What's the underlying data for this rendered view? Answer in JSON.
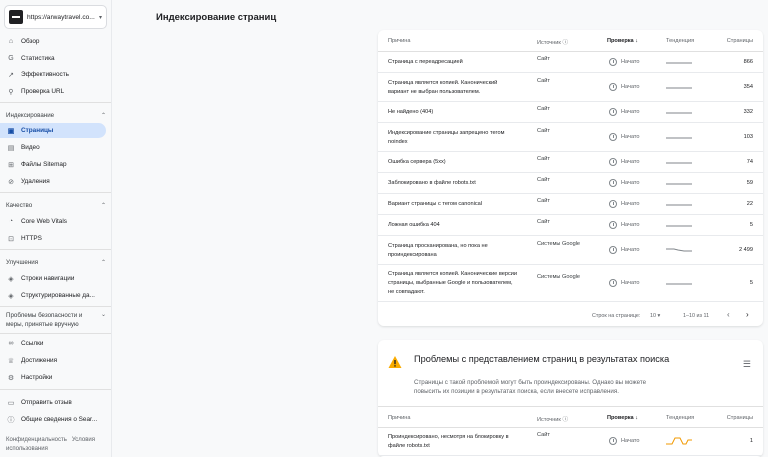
{
  "sidebar": {
    "property_url": "https://arwaytravel.co...",
    "items_top": [
      {
        "label": "Обзор",
        "icon": "home-icon"
      },
      {
        "label": "Статистика",
        "icon": "search-performance-icon"
      },
      {
        "label": "Эффективность",
        "icon": "trending-icon"
      },
      {
        "label": "Проверка URL",
        "icon": "search-icon"
      }
    ],
    "section_indexing": "Индексирование",
    "items_indexing": [
      {
        "label": "Страницы",
        "icon": "pages-icon"
      },
      {
        "label": "Видео",
        "icon": "video-icon"
      },
      {
        "label": "Файлы Sitemap",
        "icon": "sitemap-icon"
      },
      {
        "label": "Удаления",
        "icon": "removals-icon"
      }
    ],
    "section_quality": "Качество",
    "items_quality": [
      {
        "label": "Core Web Vitals",
        "icon": "speed-icon"
      },
      {
        "label": "HTTPS",
        "icon": "lock-icon"
      }
    ],
    "section_enhancements": "Улучшения",
    "items_enhancements": [
      {
        "label": "Строки навигации",
        "icon": "breadcrumb-icon"
      },
      {
        "label": "Структурированные да...",
        "icon": "structured-data-icon"
      }
    ],
    "section_security": "Проблемы безопасности и меры, принятые вручную",
    "items_links": [
      {
        "label": "Ссылки",
        "icon": "link-icon"
      },
      {
        "label": "Достижения",
        "icon": "trophy-icon"
      },
      {
        "label": "Настройки",
        "icon": "gear-icon"
      }
    ],
    "items_bottom": [
      {
        "label": "Отправить отзыв",
        "icon": "feedback-icon"
      },
      {
        "label": "Общие сведения о Sear...",
        "icon": "info-icon"
      }
    ],
    "footer_privacy": "Конфиденциальность",
    "footer_terms": "Условия использования"
  },
  "header": {
    "title": "Индексирование страниц"
  },
  "table": {
    "col_reason": "Причина",
    "col_source": "Источник",
    "col_check": "Проверка",
    "col_trend": "Тенденция",
    "col_pages": "Страницы",
    "rows": [
      {
        "reason": "Страница с переадресацией",
        "source": "Сайт",
        "check": "Начато",
        "pages": "866",
        "trend": "flat"
      },
      {
        "reason": "Страница является копией. Канонический вариант не выбран пользователем.",
        "source": "Сайт",
        "check": "Начато",
        "pages": "354",
        "trend": "flat"
      },
      {
        "reason": "Не найдено (404)",
        "source": "Сайт",
        "check": "Начато",
        "pages": "332",
        "trend": "flat"
      },
      {
        "reason": "Индексирование страницы запрещено тегом noindex",
        "source": "Сайт",
        "check": "Начато",
        "pages": "103",
        "trend": "flat"
      },
      {
        "reason": "Ошибка сервера (5xx)",
        "source": "Сайт",
        "check": "Начато",
        "pages": "74",
        "trend": "flat"
      },
      {
        "reason": "Заблокировано в файле robots.txt",
        "source": "Сайт",
        "check": "Начато",
        "pages": "59",
        "trend": "flat"
      },
      {
        "reason": "Вариант страницы с тегом canonical",
        "source": "Сайт",
        "check": "Начато",
        "pages": "22",
        "trend": "flat"
      },
      {
        "reason": "Ложная ошибка 404",
        "source": "Сайт",
        "check": "Начато",
        "pages": "5",
        "trend": "flat"
      },
      {
        "reason": "Страница просканирована, но пока не проиндексирована",
        "source": "Системы Google",
        "check": "Начато",
        "pages": "2 499",
        "trend": "down"
      },
      {
        "reason": "Страница является копией. Канонические версии страницы, выбранные Google и пользователем, не совпадают.",
        "source": "Системы Google",
        "check": "Начато",
        "pages": "5",
        "trend": "flat"
      }
    ]
  },
  "pager": {
    "rows_label": "Строк на странице:",
    "rows_value": "10",
    "range": "1–10 из 11"
  },
  "card2": {
    "title": "Проблемы с представлением страниц в результатах поиска",
    "desc": "Страницы с такой проблемой могут быть проиндексированы. Однако вы можете повысить их позиции в результатах поиска, если внесете исправления.",
    "rows": [
      {
        "reason": "Проиндексировано, несмотря на блокировку в файле robots.txt",
        "source": "Сайт",
        "check": "Начато",
        "pages": "1",
        "trend": "orange"
      }
    ]
  },
  "colors": {
    "accent": "#1a73e8",
    "active_bg": "#d2e3fc",
    "warning": "#f9ab00",
    "trend_orange": "#f29900"
  }
}
